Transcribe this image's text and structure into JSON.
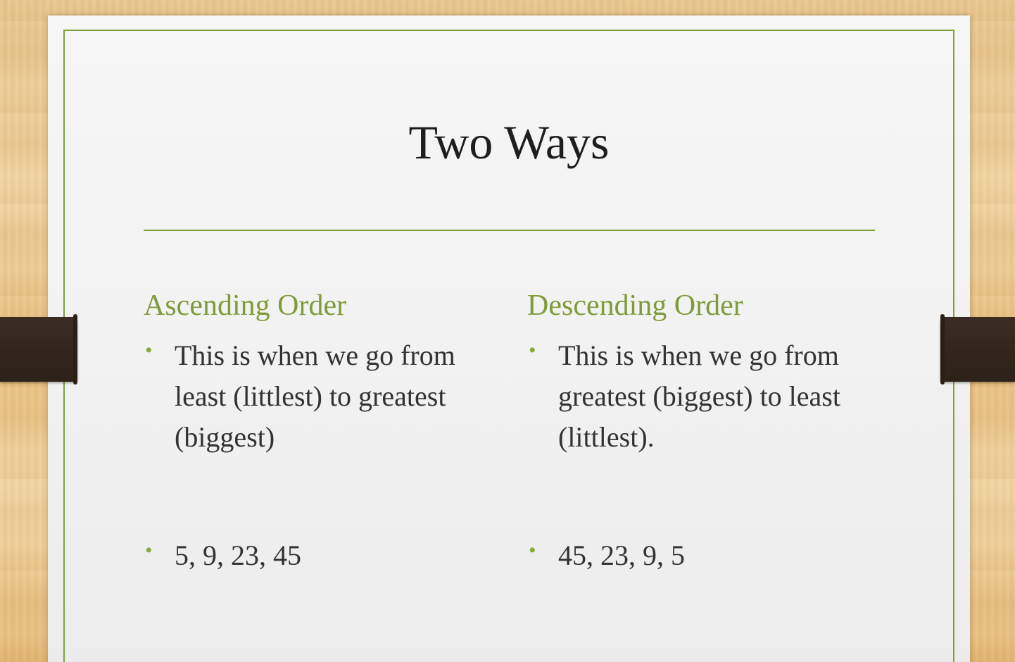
{
  "slide": {
    "title": "Two Ways",
    "columns": [
      {
        "heading": "Ascending Order",
        "bullets": [
          "This is when we go from least (littlest) to greatest (biggest)",
          "5, 9, 23, 45"
        ]
      },
      {
        "heading": "Descending Order",
        "bullets": [
          "This is when we go from greatest (biggest) to least (littlest).",
          "45, 23, 9, 5"
        ]
      }
    ],
    "bullet_glyph": "•"
  },
  "colors": {
    "accent_green": "#7fa03a",
    "text_dark": "#1e1e1e"
  }
}
